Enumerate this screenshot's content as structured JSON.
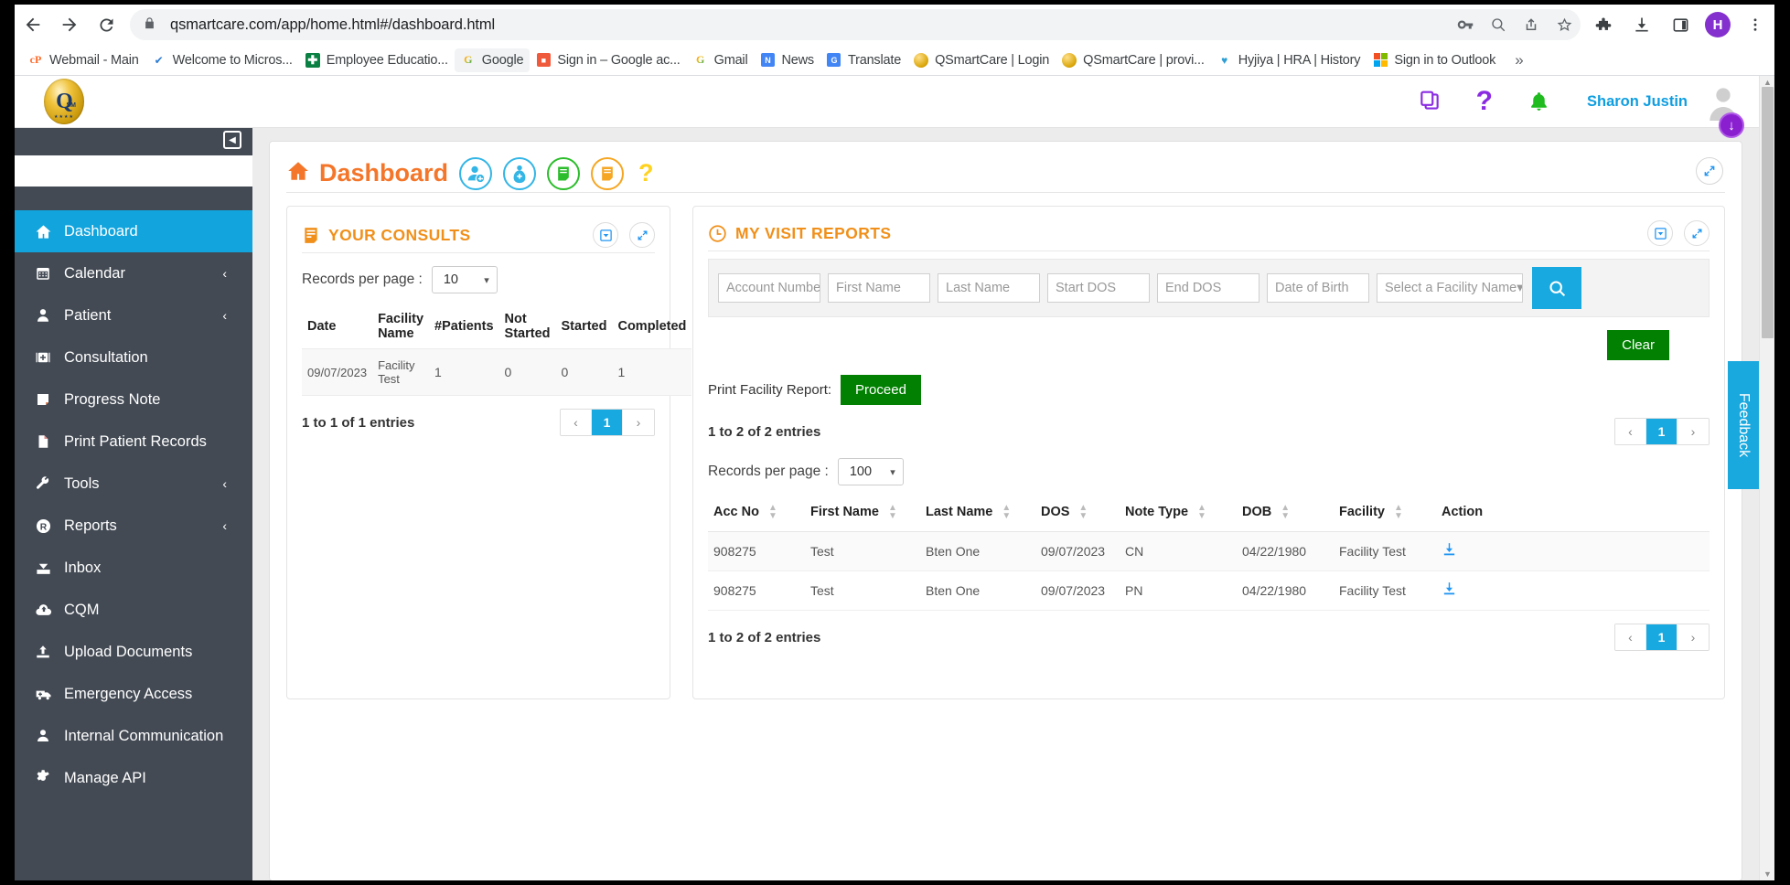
{
  "browser": {
    "url": "qsmartcare.com/app/home.html#/dashboard.html",
    "back_label": "Back",
    "forward_label": "Forward",
    "reload_label": "Reload",
    "profile_initial": "H",
    "bookmarks": [
      {
        "label": "Webmail - Main",
        "icon": "cpanel-icon",
        "glyph": "cP",
        "style": "fav-cp"
      },
      {
        "label": "Welcome to Micros...",
        "icon": "check-icon",
        "glyph": "✔",
        "style": "fav-check"
      },
      {
        "label": "Employee Educatio...",
        "icon": "plus-green-icon",
        "glyph": "✚",
        "style": "fav-green"
      },
      {
        "label": "Google",
        "icon": "google-icon",
        "glyph": "G",
        "style": "fav-g",
        "selected": true
      },
      {
        "label": "Sign in – Google ac...",
        "icon": "signin-icon",
        "glyph": "🔐",
        "style": "fav-box-red"
      },
      {
        "label": "Gmail",
        "icon": "gmail-icon",
        "glyph": "G",
        "style": "fav-g"
      },
      {
        "label": "News",
        "icon": "news-icon",
        "glyph": "N",
        "style": "fav-box-news"
      },
      {
        "label": "Translate",
        "icon": "translate-icon",
        "glyph": "G",
        "style": "fav-box-blue"
      },
      {
        "label": "QSmartCare | Login",
        "icon": "qsmartcare-icon",
        "glyph": "",
        "style": "fav-gold"
      },
      {
        "label": "QSmartCare | provi...",
        "icon": "qsmartcare-icon",
        "glyph": "",
        "style": "fav-gold"
      },
      {
        "label": "Hyjiya | HRA | History",
        "icon": "heart-icon",
        "glyph": "♥",
        "style": "fav-heart"
      },
      {
        "label": "Sign in to Outlook",
        "icon": "microsoft-icon",
        "glyph": "",
        "style": "ms-logo"
      }
    ],
    "overflow_label": "»",
    "toolbar_icons": [
      {
        "name": "password-key-icon"
      },
      {
        "name": "zoom-out-icon"
      },
      {
        "name": "share-icon"
      },
      {
        "name": "bookmark-star-icon"
      },
      {
        "name": "extensions-puzzle-icon"
      },
      {
        "name": "downloads-icon"
      },
      {
        "name": "side-panel-icon"
      },
      {
        "name": "profile-avatar-icon"
      },
      {
        "name": "chrome-menu-icon"
      }
    ]
  },
  "app_header": {
    "logo_letter": "Q",
    "logo_sub": "SM",
    "logo_stars": "★★★★",
    "user_name": "Sharon Justin",
    "icons": [
      {
        "name": "copy-icon"
      },
      {
        "name": "help-question-icon"
      },
      {
        "name": "notification-bell-icon"
      },
      {
        "name": "user-avatar-icon"
      }
    ],
    "download_badge": "↓"
  },
  "sidebar": {
    "collapse_label": "◀",
    "items": [
      {
        "label": "Dashboard",
        "icon": "home-icon",
        "glyph": "🏠",
        "active": true,
        "caret": ""
      },
      {
        "label": "Calendar",
        "icon": "calendar-icon",
        "glyph": "📅",
        "active": false,
        "caret": "‹"
      },
      {
        "label": "Patient",
        "icon": "person-icon",
        "glyph": "👤",
        "active": false,
        "caret": "‹"
      },
      {
        "label": "Consultation",
        "icon": "medical-bag-icon",
        "glyph": "⊕",
        "active": false,
        "caret": ""
      },
      {
        "label": "Progress Note",
        "icon": "note-icon",
        "glyph": "▤",
        "active": false,
        "caret": ""
      },
      {
        "label": "Print Patient Records",
        "icon": "document-icon",
        "glyph": "🗋",
        "active": false,
        "caret": ""
      },
      {
        "label": "Tools",
        "icon": "wrench-icon",
        "glyph": "🔧",
        "active": false,
        "caret": "‹"
      },
      {
        "label": "Reports",
        "icon": "reports-r-icon",
        "glyph": "Ⓡ",
        "active": false,
        "caret": "‹"
      },
      {
        "label": "Inbox",
        "icon": "inbox-icon",
        "glyph": "📥",
        "active": false,
        "caret": ""
      },
      {
        "label": "CQM",
        "icon": "cloud-upload-icon",
        "glyph": "☁",
        "active": false,
        "caret": ""
      },
      {
        "label": "Upload Documents",
        "icon": "upload-icon",
        "glyph": "⇧",
        "active": false,
        "caret": ""
      },
      {
        "label": "Emergency Access",
        "icon": "ambulance-icon",
        "glyph": "🚑",
        "active": false,
        "caret": ""
      },
      {
        "label": "Internal Communication",
        "icon": "user-chat-icon",
        "glyph": "👤",
        "active": false,
        "caret": ""
      },
      {
        "label": "Manage API",
        "icon": "gear-icon",
        "glyph": "⚙",
        "active": false,
        "caret": ""
      }
    ]
  },
  "dashboard": {
    "title": "Dashboard",
    "home_icon": "home-icon",
    "actions": [
      {
        "name": "add-patient-icon",
        "color": "blue"
      },
      {
        "name": "new-consult-icon",
        "color": "blue"
      },
      {
        "name": "green-note-icon",
        "color": "green"
      },
      {
        "name": "orange-note-icon",
        "color": "orange"
      },
      {
        "name": "help-question-icon",
        "color": "yellow"
      }
    ],
    "expand_icon": "expand-icon"
  },
  "consults": {
    "title": "YOUR CONSULTS",
    "title_icon": "list-icon",
    "actions": [
      {
        "name": "collapse-box-icon"
      },
      {
        "name": "expand-icon"
      }
    ],
    "records_per_page_label": "Records per page :",
    "records_per_page_value": "10",
    "columns": [
      "Date",
      "Facility Name",
      "#Patients",
      "Not Started",
      "Started",
      "Completed"
    ],
    "rows": [
      {
        "date": "09/07/2023",
        "facility": "Facility Test",
        "patients": "1",
        "not_started": "0",
        "started": "0",
        "completed": "1"
      }
    ],
    "entries_text": "1 to 1 of 1 entries",
    "pager": {
      "prev": "‹",
      "pages": [
        "1"
      ],
      "next": "›",
      "current": "1"
    }
  },
  "visits": {
    "title": "MY VISIT REPORTS",
    "title_icon": "clock-icon",
    "actions": [
      {
        "name": "collapse-box-icon"
      },
      {
        "name": "expand-icon"
      }
    ],
    "filters": [
      {
        "name": "account-number-input",
        "placeholder": "Account Number"
      },
      {
        "name": "first-name-input",
        "placeholder": "First Name"
      },
      {
        "name": "last-name-input",
        "placeholder": "Last Name"
      },
      {
        "name": "start-dos-input",
        "placeholder": "Start DOS"
      },
      {
        "name": "end-dos-input",
        "placeholder": "End DOS"
      },
      {
        "name": "date-of-birth-input",
        "placeholder": "Date of Birth"
      }
    ],
    "facility_select": {
      "placeholder": "Select a Facility Name",
      "caret": "▾"
    },
    "search_icon": "search-icon",
    "clear_label": "Clear",
    "print_label": "Print Facility Report:",
    "proceed_label": "Proceed",
    "entries_text_top": "1 to 2 of 2 entries",
    "entries_text_bottom": "1 to 2 of 2 entries",
    "records_per_page_label": "Records per page :",
    "records_per_page_value": "100",
    "columns": [
      "Acc No",
      "First Name",
      "Last Name",
      "DOS",
      "Note Type",
      "DOB",
      "Facility",
      "Action"
    ],
    "rows": [
      {
        "acc": "908275",
        "first": "Test",
        "last": "Bten One",
        "dos": "09/07/2023",
        "note_type": "CN",
        "dob": "04/22/1980",
        "facility": "Facility Test",
        "action_icon": "download-icon"
      },
      {
        "acc": "908275",
        "first": "Test",
        "last": "Bten One",
        "dos": "09/07/2023",
        "note_type": "PN",
        "dob": "04/22/1980",
        "facility": "Facility Test",
        "action_icon": "download-icon"
      }
    ],
    "pager_top": {
      "prev": "‹",
      "pages": [
        "1"
      ],
      "next": "›",
      "current": "1"
    },
    "pager_bottom": {
      "prev": "‹",
      "pages": [
        "1"
      ],
      "next": "›",
      "current": "1"
    }
  },
  "feedback": {
    "label": "Feedback"
  },
  "colors": {
    "accent_blue": "#18a9e0",
    "sidebar_bg": "#434a54",
    "brand_orange": "#f4762a",
    "panel_title_orange": "#f0901b",
    "green_button": "#018001",
    "acc_link_pink": "#ff3dd0"
  }
}
